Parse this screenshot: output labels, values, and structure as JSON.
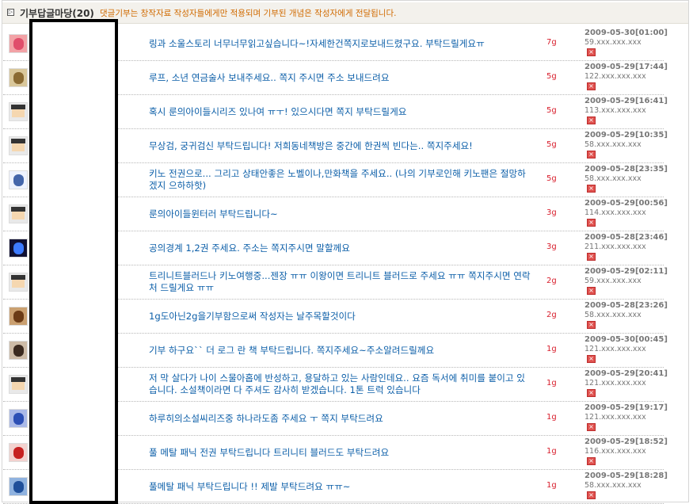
{
  "header": {
    "title": "기부답글마당",
    "count": "(20)",
    "note": "댓글기부는 창작자료 작성자들에게만 적용되며 기부된 개념은 작성자에게 전달됩니다.",
    "box_glyph": "▷"
  },
  "rows": [
    {
      "message": "링과 소울스토리 너무너무읽고싶습니다~!자세한건쪽지로보내드렸구요. 부탁드릴게요ㅠ",
      "points": "7g",
      "date": "2009-05-30[01:00]",
      "ip": "59.xxx.xxx.xxx"
    },
    {
      "message": "루프, 소년 연금술사 보내주세요.. 쪽지 주시면 주소 보내드려요",
      "points": "5g",
      "date": "2009-05-29[17:44]",
      "ip": "122.xxx.xxx.xxx"
    },
    {
      "message": "혹시 룬의아이들시리즈 있나여 ㅠㅜ! 있으시다면 쪽지 부탁드릴게요",
      "points": "5g",
      "date": "2009-05-29[16:41]",
      "ip": "113.xxx.xxx.xxx"
    },
    {
      "message": "무상검, 궁귀검신 부탁드립니다! 저희동네책방은 중간에 한권씩 빈다는.. 쪽지주세요!",
      "points": "5g",
      "date": "2009-05-29[10:35]",
      "ip": "58.xxx.xxx.xxx"
    },
    {
      "message": "키노 전권으로... 그리고 상태안좋은 노벨이나,만화책을 주세요.. (나의 기부로인해 키노팬은 절망하겠지 으하하핫)",
      "points": "5g",
      "date": "2009-05-28[23:35]",
      "ip": "58.xxx.xxx.xxx"
    },
    {
      "message": "룬의아이들윈터러 부탁드립니다~",
      "points": "3g",
      "date": "2009-05-29[00:56]",
      "ip": "114.xxx.xxx.xxx"
    },
    {
      "message": "공의경계 1,2권 주세요. 주소는 쪽지주시면 말할께요",
      "points": "3g",
      "date": "2009-05-28[23:46]",
      "ip": "211.xxx.xxx.xxx"
    },
    {
      "message": "트리니트블러드나 키노여행중...젠장 ㅠㅠ 이왕이면 트리니트 블러드로 주세요 ㅠㅠ 쪽지주시면 연락처 드릴게요 ㅠㅠ",
      "points": "2g",
      "date": "2009-05-29[02:11]",
      "ip": "59.xxx.xxx.xxx"
    },
    {
      "message": "1g도아닌2g을기부함으로써 작성자는 날주목할것이다",
      "points": "2g",
      "date": "2009-05-28[23:26]",
      "ip": "58.xxx.xxx.xxx"
    },
    {
      "message": "기부 하구요`` 더 로그 란 책 부탁드립니다. 쪽지주세요~주소알려드릴께요",
      "points": "1g",
      "date": "2009-05-30[00:45]",
      "ip": "121.xxx.xxx.xxx"
    },
    {
      "message": "저 막 살다가 나이 스물아홉에 반성하고, 용달하고 있는 사람인데요.. 요즘 독서에 취미를 붙이고 있습니다. 소설책이라면 다 주셔도 감사히 받겠습니다. 1톤 트럭 있습니다",
      "points": "1g",
      "date": "2009-05-29[20:41]",
      "ip": "121.xxx.xxx.xxx"
    },
    {
      "message": "하루히의소설씨리즈중 하나라도좀 주세요 ㅜ 쪽지 부탁드려요",
      "points": "1g",
      "date": "2009-05-29[19:17]",
      "ip": "121.xxx.xxx.xxx"
    },
    {
      "message": "풀 메탈 패닉 전권 부탁드립니다 트리니티 블러드도 부탁드려요",
      "points": "1g",
      "date": "2009-05-29[18:52]",
      "ip": "116.xxx.xxx.xxx"
    },
    {
      "message": "풀메탈 패닉 부탁드립니다 !! 제발 부탁드려요 ㅠㅠ~",
      "points": "1g",
      "date": "2009-05-29[18:28]",
      "ip": "58.xxx.xxx.xxx"
    }
  ],
  "colors": {
    "message_link": "#0b5ea8",
    "points": "#d81e2c",
    "header_note": "#d06a00",
    "header_bg": "#f3f1ec",
    "delete_button": "#e0524f"
  },
  "avatars": [
    "pink-character",
    "scroll",
    "pixel-face",
    "pixel-face",
    "sketch",
    "pixel-face",
    "blue-star",
    "pixel-face",
    "bear",
    "girl-photo",
    "pixel-face",
    "blue-flower",
    "red-figure",
    "blue-square"
  ],
  "delete_glyph": "×"
}
